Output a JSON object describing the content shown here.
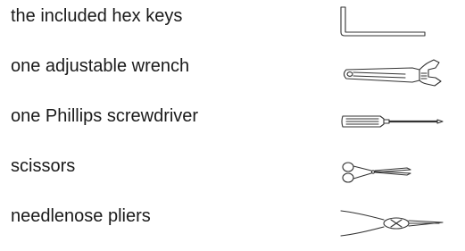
{
  "tools": [
    {
      "label": "the included hex keys",
      "icon": "hex-key-icon"
    },
    {
      "label": "one adjustable wrench",
      "icon": "adjustable-wrench-icon"
    },
    {
      "label": "one Phillips screwdriver",
      "icon": "phillips-screwdriver-icon"
    },
    {
      "label": "scissors",
      "icon": "scissors-icon"
    },
    {
      "label": "needlenose pliers",
      "icon": "needlenose-pliers-icon"
    }
  ],
  "colors": {
    "text": "#1a1a1a",
    "line_art": "#333333",
    "background": "#ffffff"
  }
}
